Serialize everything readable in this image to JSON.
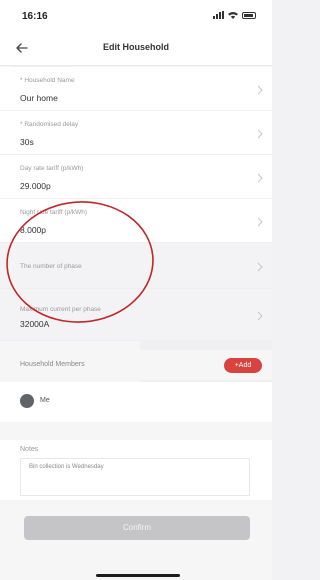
{
  "status_bar": {
    "time": "16:16"
  },
  "nav": {
    "title": "Edit Household"
  },
  "fields": [
    {
      "label": "* Household Name",
      "value": "Our home"
    },
    {
      "label": "* Randomised delay",
      "value": "30s"
    },
    {
      "label": "Day rate tariff (p/kWh)",
      "value": "29.000p"
    },
    {
      "label": "Night rate tariff (p/kWh)",
      "value": "8.000p"
    },
    {
      "label": "The number of phase",
      "value": ""
    },
    {
      "label": "Maximum current per phase",
      "value": "32000A"
    }
  ],
  "members": {
    "title": "Household Members",
    "add_label": "+Add",
    "items": [
      {
        "name": "Me"
      }
    ]
  },
  "notes": {
    "label": "Notes",
    "value": "Bin collection is Wednesday"
  },
  "confirm_label": "Confirm",
  "colors": {
    "accent": "#d9433f",
    "highlight_circle": "#c0262a",
    "button_disabled": "#c5c5c8"
  }
}
